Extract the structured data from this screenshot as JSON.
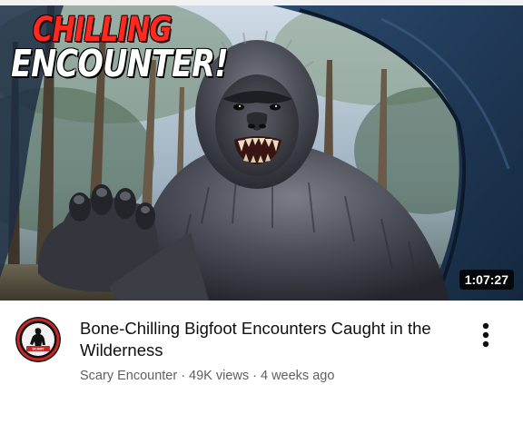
{
  "thumbnail": {
    "overlay_line1": "CHILLING",
    "overlay_line2": "ENCOUNTER!",
    "duration": "1:07:27",
    "subject_icon": "bigfoot-creature-image"
  },
  "video": {
    "title": "Bone-Chilling Bigfoot Encounters Caught in the Wilderness",
    "channel": "Scary Encounter",
    "views": "49K views",
    "age": "4 weeks ago",
    "separator": "·"
  },
  "channel_avatar": {
    "icon": "bigfoot-logo-icon",
    "accent_color": "#c62828"
  },
  "more_button": {
    "icon": "vertical-ellipsis-icon"
  },
  "colors": {
    "title": "#0f0f0f",
    "meta": "#606060",
    "overlay_red": "#ff2a1f",
    "overlay_white": "#ffffff"
  }
}
